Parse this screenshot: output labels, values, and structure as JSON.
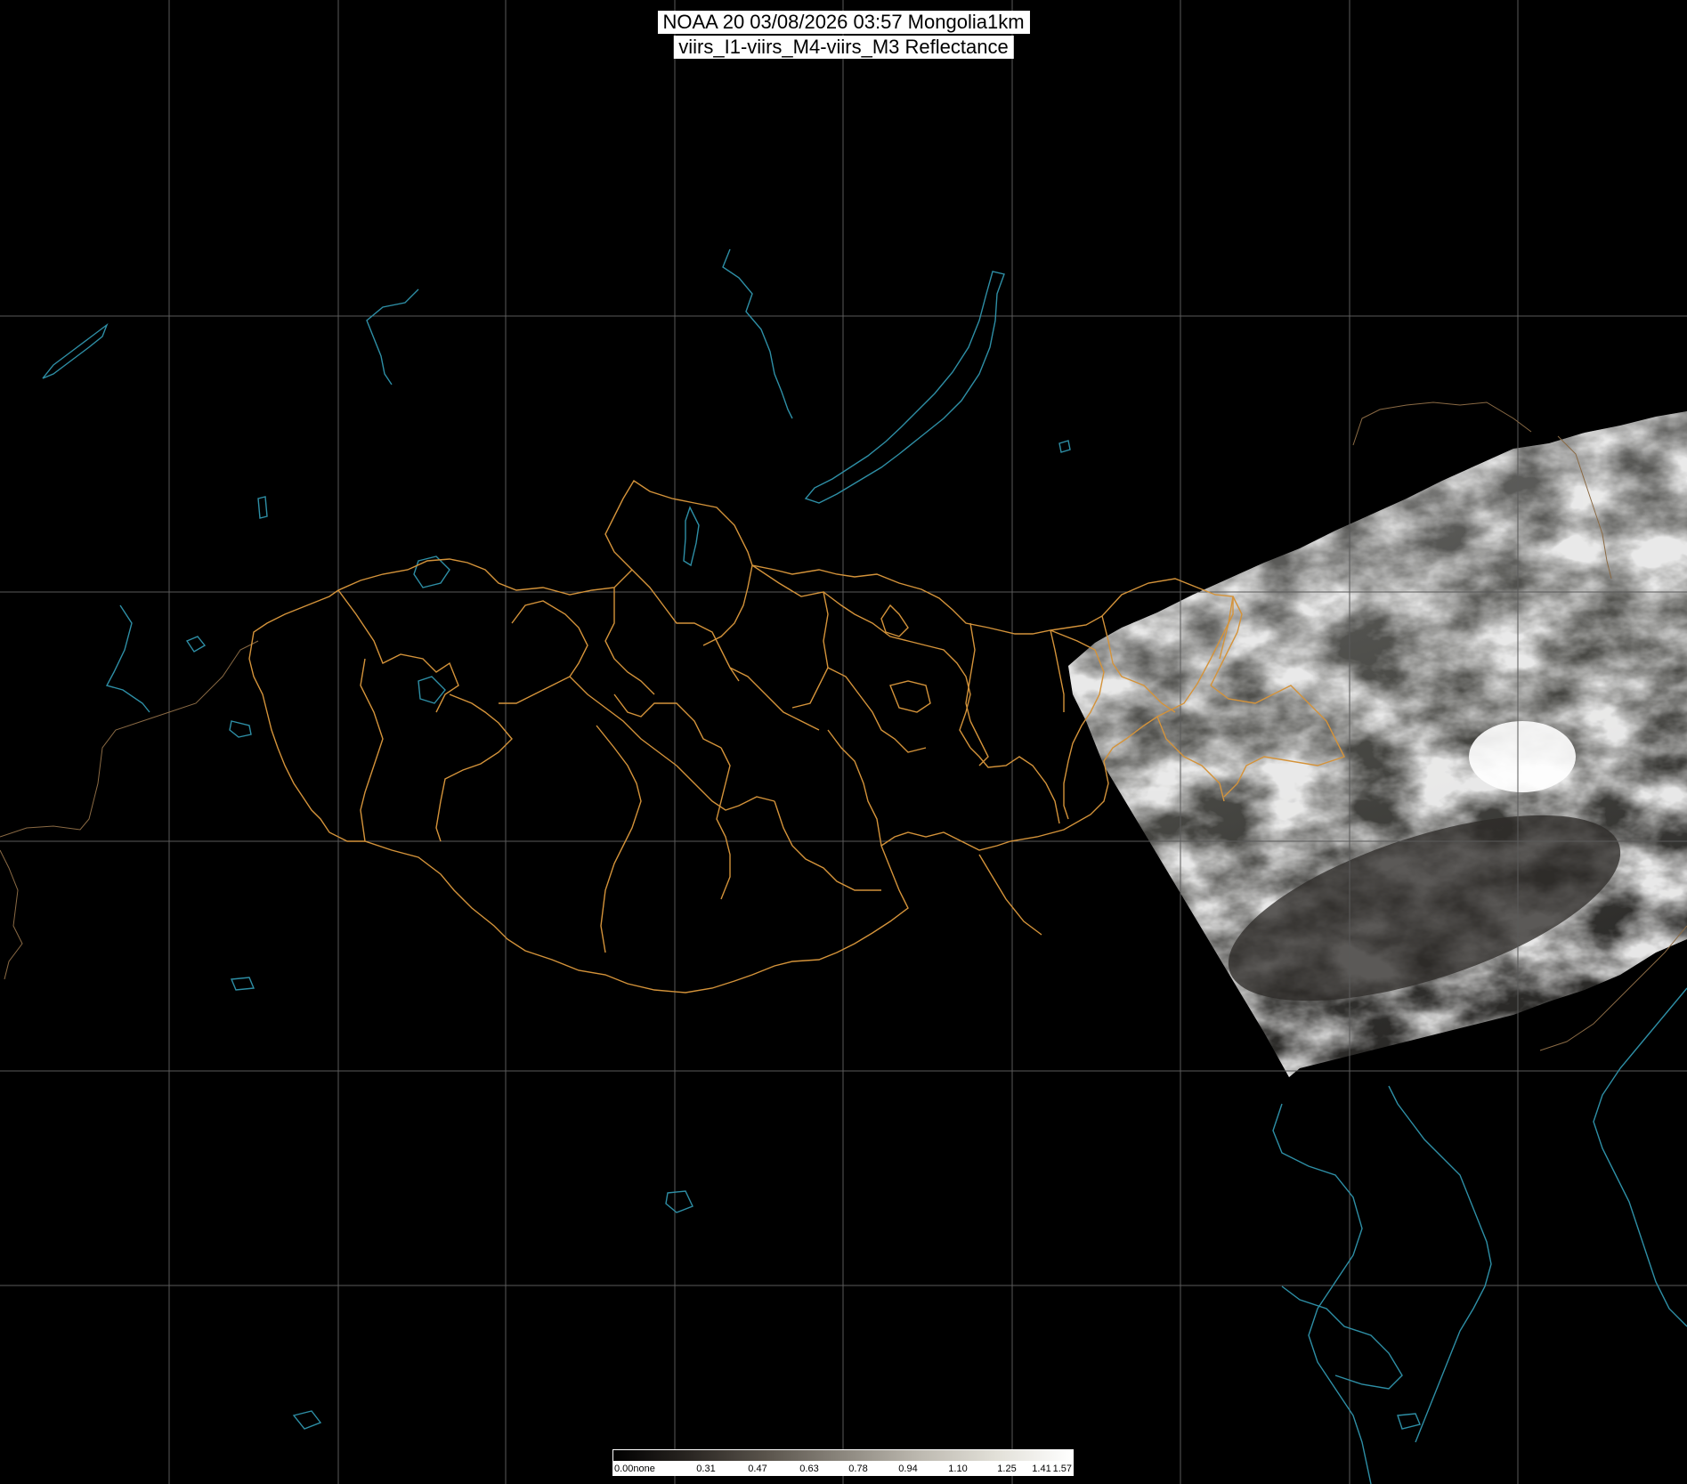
{
  "title": {
    "line1": "NOAA 20 03/08/2026 03:57 Mongolia1km",
    "line2": "viirs_I1-viirs_M4-viirs_M3 Reflectance"
  },
  "colorbar": {
    "labels": [
      "0.00none",
      "0.31",
      "0.47",
      "0.63",
      "0.78",
      "0.94",
      "1.10",
      "1.25",
      "1.41",
      "1.57"
    ],
    "gradient": [
      "#000000",
      "#2a2622",
      "#5a544c",
      "#8c877e",
      "#bdb9b0",
      "#e2e0d8",
      "#ffffff"
    ]
  },
  "colors": {
    "background": "#000000",
    "graticule": "#5a5a5a",
    "admin_borders": "#d4933a",
    "coastlines_water": "#2e8fa6",
    "country_borders": "#8a6a44"
  },
  "layers": [
    "graticule",
    "coastlines-and-lakes",
    "admin-borders",
    "satellite-swath",
    "title",
    "colorbar"
  ]
}
